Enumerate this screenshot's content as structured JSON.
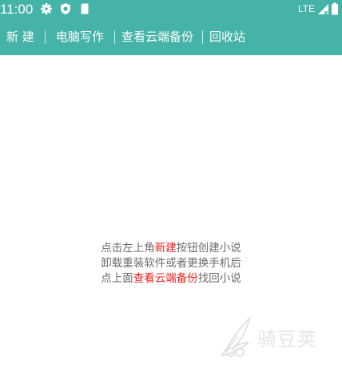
{
  "status_bar": {
    "time": "11:00",
    "network": "LTE",
    "icons": [
      "gear-icon",
      "shield-icon",
      "sd-card-icon",
      "signal-icon",
      "battery-icon"
    ]
  },
  "toolbar": {
    "items": [
      {
        "label": "新 建"
      },
      {
        "label": "电脑写作"
      },
      {
        "label": "查看云端备份"
      },
      {
        "label": "回收站"
      }
    ]
  },
  "empty_state": {
    "line1_prefix": "点击左上角",
    "line1_highlight": "新建",
    "line1_suffix": "按钮创建小说",
    "line2": "卸载重装软件或者更换手机后",
    "line3_prefix": "点上面",
    "line3_highlight": "查看云端备份",
    "line3_suffix": "找回小说"
  },
  "watermark": {
    "text": "骑豆荚",
    "logo_icon": "feather-logo-icon"
  },
  "colors": {
    "primary": "#45b3a8",
    "highlight": "#e8201e",
    "text_gray": "#6b6b6b"
  }
}
